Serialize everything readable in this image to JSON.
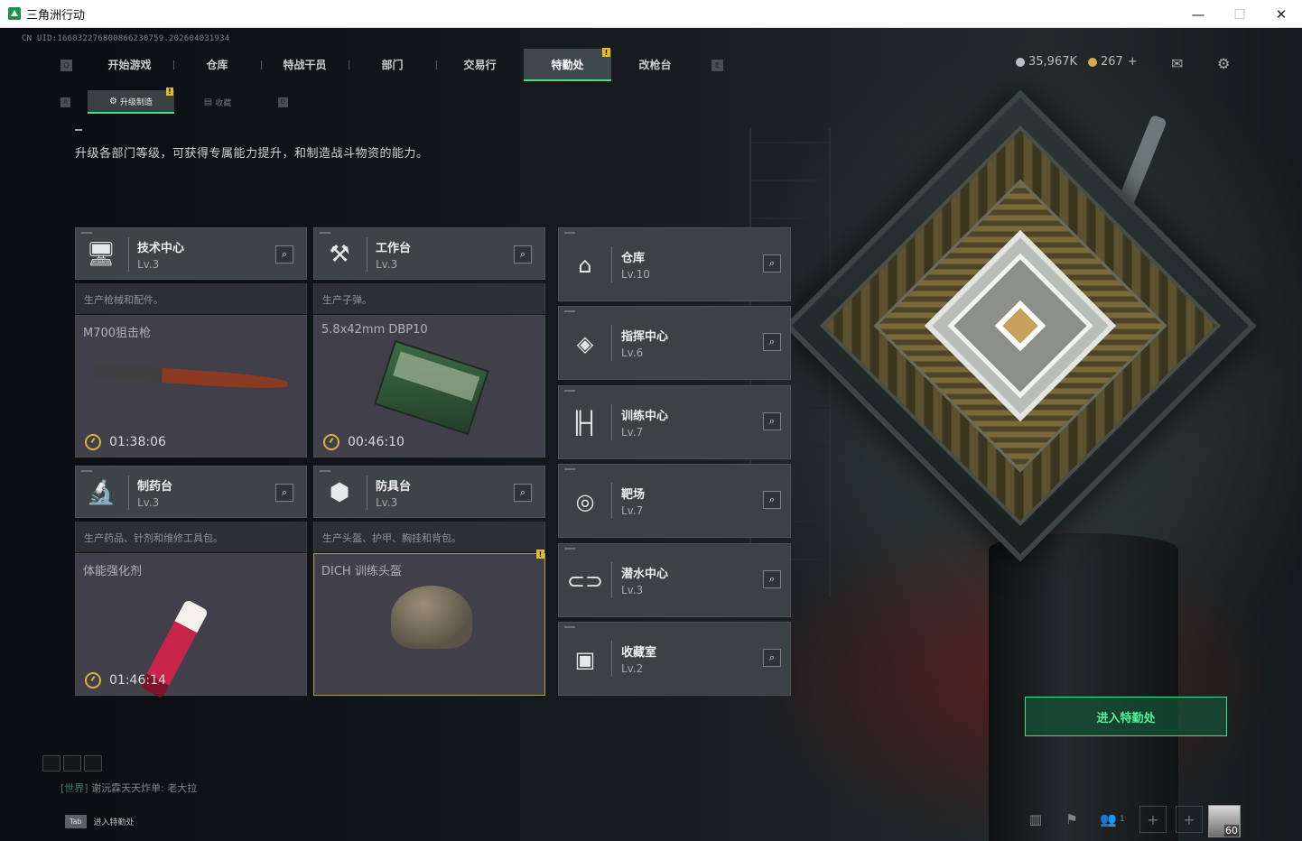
{
  "window": {
    "title": "三角洲行动",
    "controls": [
      "—",
      "☐",
      "✕"
    ]
  },
  "uid": "CN UID:166032276800866230759.202604031934",
  "nav": {
    "left_key": "Q",
    "right_key": "E",
    "tabs": [
      "开始游戏",
      "仓库",
      "特战干员",
      "部门",
      "交易行",
      "特勤处",
      "改枪台"
    ],
    "active_tab": "特勤处",
    "badge": "!"
  },
  "subnav": {
    "left_key": "A",
    "right_key": "D",
    "tabs": [
      "升级制造",
      "收藏"
    ],
    "active": "升级制造",
    "badge": "!"
  },
  "currency": {
    "silver": "35,967K",
    "gold": "267",
    "add": "+",
    "silver_color": "#b9c0c4",
    "gold_color": "#d6a94a"
  },
  "header_icons": [
    "mail-icon",
    "gear-icon"
  ],
  "intro_text": "升级各部门等级，可获得专属能力提升，和制造战斗物资的能力。",
  "production_cards": [
    {
      "name": "技术中心",
      "level": "Lv.3",
      "icon": "computer-icon",
      "desc": "生产枪械和配件。",
      "item": "M700狙击枪",
      "timer": "01:38:06"
    },
    {
      "name": "工作台",
      "level": "Lv.3",
      "icon": "hammer-icon",
      "desc": "生产子弹。",
      "item": "5.8x42mm DBP10",
      "timer": "00:46:10"
    },
    {
      "name": "制药台",
      "level": "Lv.3",
      "icon": "microscope-icon",
      "desc": "生产药品、针剂和维修工具包。",
      "item": "体能强化剂",
      "timer": "01:46:14"
    },
    {
      "name": "防具台",
      "level": "Lv.3",
      "icon": "cubes-icon",
      "desc": "生产头盔、护甲、胸挂和背包。",
      "item": "DICH 训练头盔",
      "timer": "",
      "badge": "!"
    }
  ],
  "departments": [
    {
      "name": "仓库",
      "level": "Lv.10",
      "icon": "warehouse-icon"
    },
    {
      "name": "指挥中心",
      "level": "Lv.6",
      "icon": "command-icon"
    },
    {
      "name": "训练中心",
      "level": "Lv.7",
      "icon": "dumbbell-icon"
    },
    {
      "name": "靶场",
      "level": "Lv.7",
      "icon": "target-icon"
    },
    {
      "name": "潜水中心",
      "level": "Lv.3",
      "icon": "goggles-icon"
    },
    {
      "name": "收藏室",
      "level": "Lv.2",
      "icon": "trophy-icon"
    }
  ],
  "enter_button": "进入特勤处",
  "chat": {
    "channel": "[世界]",
    "message": "谢沅霖天天炸单: 老大拉"
  },
  "tab_hint": {
    "key": "Tab",
    "label": "进入特勤处"
  },
  "bottom_bar": {
    "friends_count": "1",
    "player_level": "60"
  },
  "colors": {
    "accent": "#3fe08a",
    "badge": "#e8b928",
    "timer_icon": "#d9b340"
  }
}
